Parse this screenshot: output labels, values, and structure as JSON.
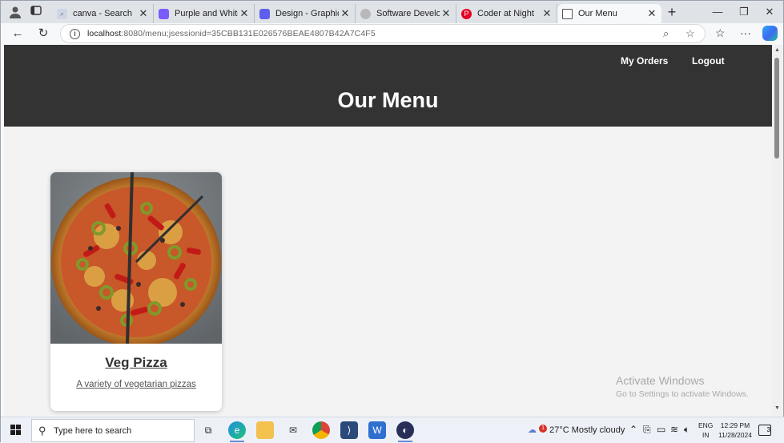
{
  "browser": {
    "tabs": [
      {
        "title": "canva - Search",
        "favicon": "search-favicon",
        "color": "#8a8a8a"
      },
      {
        "title": "Purple and White Clean",
        "favicon": "canva-favicon",
        "color": "#7a5cff"
      },
      {
        "title": "Design - Graphic Design",
        "favicon": "canva-favicon",
        "color": "#5d5fef"
      },
      {
        "title": "Software Developer Coder",
        "favicon": "site-favicon",
        "color": "#9e9e9e"
      },
      {
        "title": "Coder at Night",
        "favicon": "pinterest-favicon",
        "color": "#e60023"
      },
      {
        "title": "Our Menu",
        "favicon": "page-favicon",
        "color": "#ffffff"
      }
    ],
    "url_host": "localhost",
    "url_rest": ":8080/menu;jsessionid=35CBB131E026576BEAE4807B42A7C4F5"
  },
  "site": {
    "nav_my_orders": "My Orders",
    "nav_logout": "Logout",
    "title": "Our Menu",
    "header_color": "#333333"
  },
  "menu": {
    "items": [
      {
        "name": "Veg Pizza",
        "description": "A variety of vegetarian pizzas"
      }
    ]
  },
  "watermark": {
    "line1": "Activate Windows",
    "line2": "Go to Settings to activate Windows."
  },
  "taskbar": {
    "search_placeholder": "Type here to search",
    "temperature": "27°C",
    "weather_text": "Mostly cloudy",
    "lang_line1": "ENG",
    "lang_line2": "IN",
    "time": "12:29 PM",
    "date": "11/28/2024",
    "notification_count": "3",
    "weather_alert": "1"
  }
}
